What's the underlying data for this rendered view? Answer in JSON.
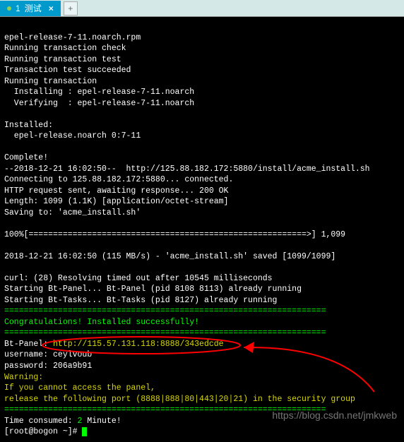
{
  "tab": {
    "index": "1",
    "title": "测试",
    "close": "×"
  },
  "newtab": "+",
  "lines": {
    "l1": "epel-release-7-11.noarch.rpm",
    "l2": "Running transaction check",
    "l3": "Running transaction test",
    "l4": "Transaction test succeeded",
    "l5": "Running transaction",
    "l6": "  Installing : epel-release-7-11.noarch",
    "l7": "  Verifying  : epel-release-7-11.noarch",
    "l8": "",
    "l9": "Installed:",
    "l10": "  epel-release.noarch 0:7-11",
    "l11": "",
    "l12": "Complete!",
    "l13": "--2018-12-21 16:02:50--  http://125.88.182.172:5880/install/acme_install.sh",
    "l14": "Connecting to 125.88.182.172:5880... connected.",
    "l15": "HTTP request sent, awaiting response... 200 OK",
    "l16": "Length: 1099 (1.1K) [application/octet-stream]",
    "l17": "Saving to: 'acme_install.sh'",
    "l18": "",
    "l19": "100%[=========================================================>] 1,099",
    "l20": "",
    "l21": "2018-12-21 16:02:50 (115 MB/s) - 'acme_install.sh' saved [1099/1099]",
    "l22": "",
    "l23": "curl: (28) Resolving timed out after 10545 milliseconds",
    "l24": "Starting Bt-Panel... Bt-Panel (pid 8108 8113) already running",
    "l25": "Starting Bt-Tasks... Bt-Tasks (pid 8127) already running",
    "sep1": "==================================================================",
    "congrats": "Congratulations! Installed successfully!",
    "sep2": "==================================================================",
    "panel_label": "Bt-Panel: ",
    "panel_url": "http://115.57.131.118:8888/343edcde",
    "user_label": "username: ",
    "user_val": "ceylvoub",
    "pass_label": "password: ",
    "pass_val": "206a9b91",
    "warn": "Warning:",
    "warn1": "If you cannot access the panel,",
    "warn2": "release the following port (8888|888|80|443|20|21) in the security group",
    "sep3": "==================================================================",
    "time_label": "Time consumed: ",
    "time_num": "2",
    "time_unit": " Minute!",
    "prompt": "[root@bogon ~]# "
  },
  "watermark": "https://blog.csdn.net/jmkweb"
}
